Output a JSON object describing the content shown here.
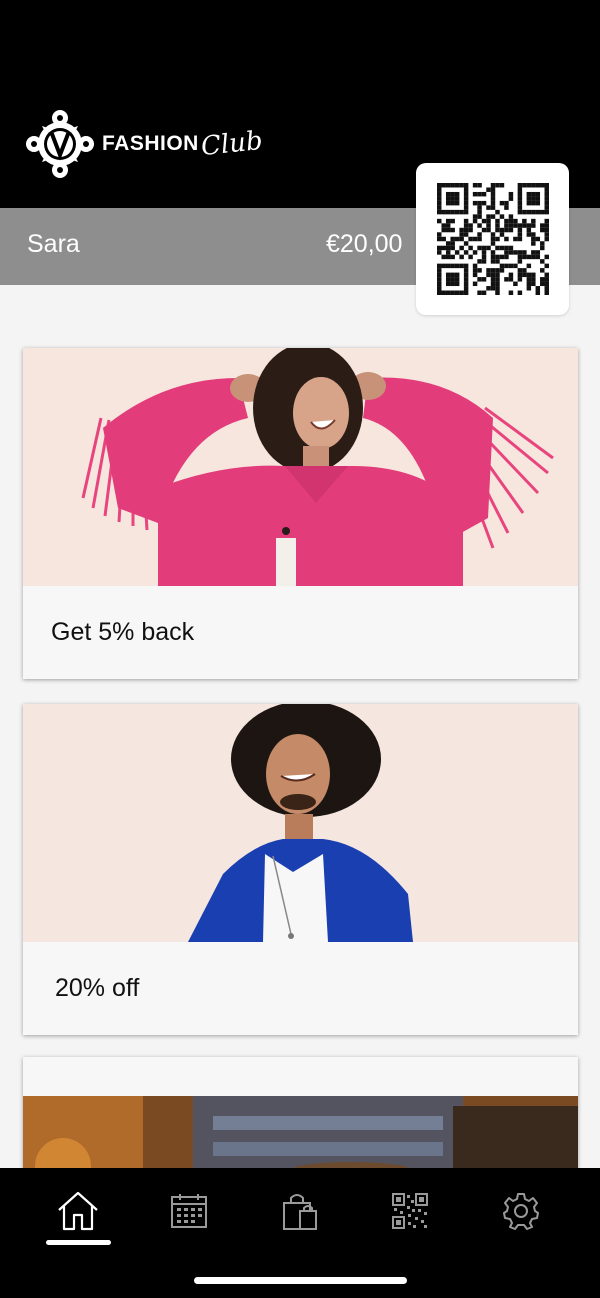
{
  "brand": {
    "word": "FASHION",
    "script": "Club"
  },
  "user": {
    "name": "Sara",
    "balance": "€20,00"
  },
  "offers": [
    {
      "caption": "Get 5% back"
    },
    {
      "caption": "20% off"
    },
    {
      "caption": ""
    }
  ],
  "tabs": [
    {
      "icon": "home-icon",
      "active": true
    },
    {
      "icon": "calendar-icon",
      "active": false
    },
    {
      "icon": "shopping-bag-icon",
      "active": false
    },
    {
      "icon": "qr-code-icon",
      "active": false
    },
    {
      "icon": "gear-icon",
      "active": false
    }
  ],
  "colors": {
    "header_bg": "#000000",
    "userbar_bg": "#8e8e8e",
    "page_bg": "#f4f4f4",
    "jacket_pink": "#e23d7a",
    "jacket_blue": "#1a3fb0"
  }
}
